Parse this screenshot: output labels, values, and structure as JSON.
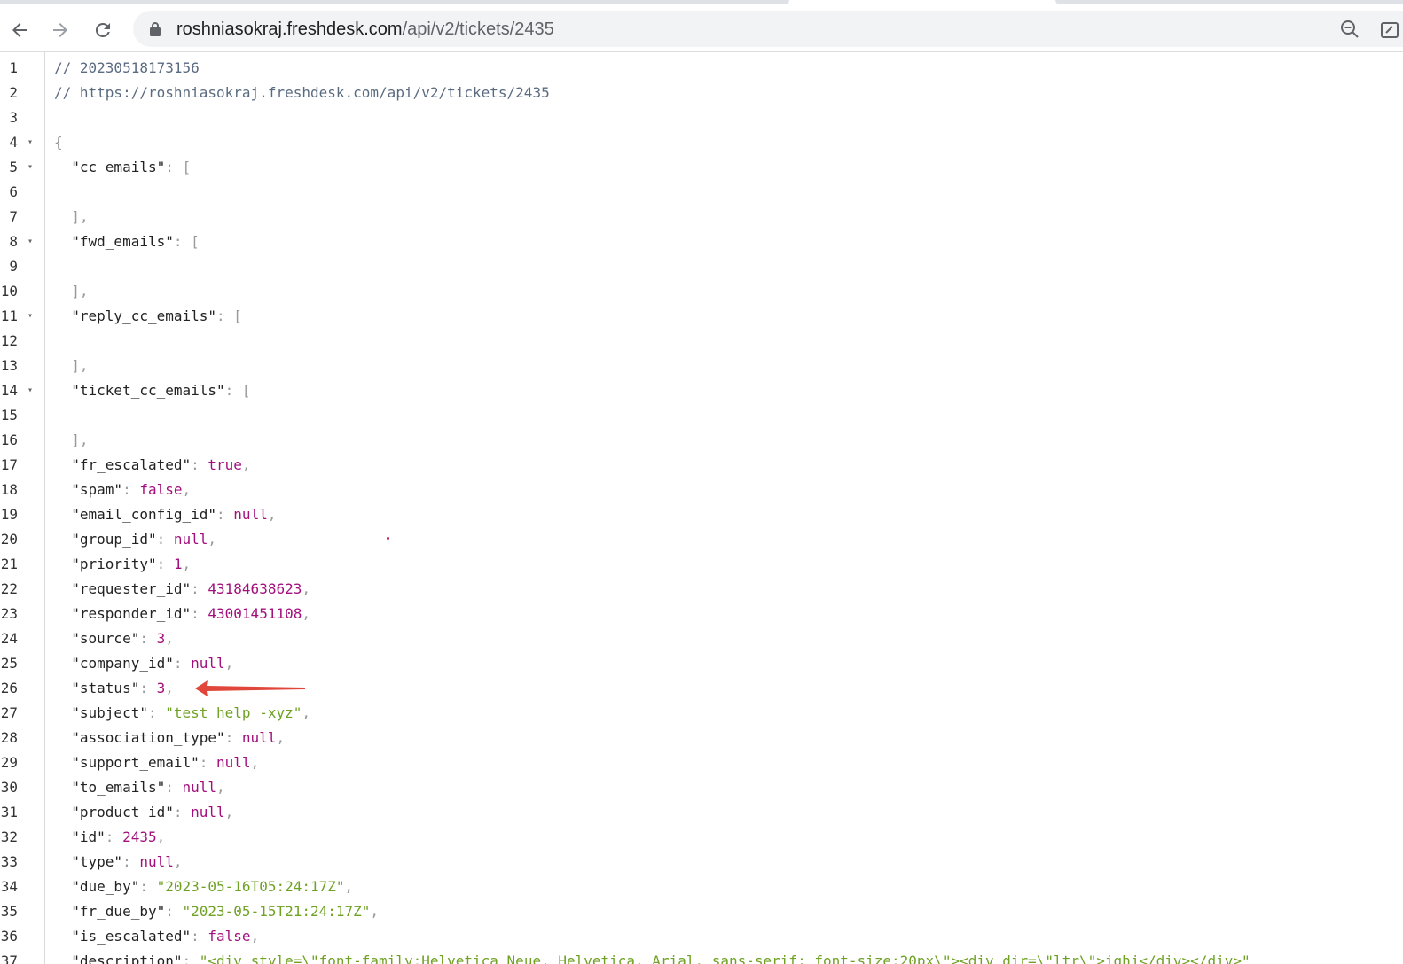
{
  "browser": {
    "url_host": "roshniasokraj.freshdesk.com",
    "url_path": "/api/v2/tickets/2435",
    "icons": {
      "back": "arrow-left-icon",
      "forward": "arrow-right-icon",
      "reload": "reload-icon",
      "lock": "lock-icon",
      "zoom": "zoom-out-icon"
    }
  },
  "json_view": {
    "lines": [
      {
        "n": "1",
        "fold": "",
        "tokens": [
          {
            "t": "// 20230518173156",
            "c": "comment"
          }
        ]
      },
      {
        "n": "2",
        "fold": "",
        "tokens": [
          {
            "t": "// https://roshniasokraj.freshdesk.com/api/v2/tickets/2435",
            "c": "comment"
          }
        ]
      },
      {
        "n": "3",
        "fold": "",
        "tokens": []
      },
      {
        "n": "4",
        "fold": "▾",
        "tokens": [
          {
            "t": "{",
            "c": "punct"
          }
        ]
      },
      {
        "n": "5",
        "fold": "▾",
        "tokens": [
          {
            "t": "  \"cc_emails\"",
            "c": "key"
          },
          {
            "t": ": [",
            "c": "punct"
          }
        ]
      },
      {
        "n": "6",
        "fold": "",
        "tokens": []
      },
      {
        "n": "7",
        "fold": "",
        "tokens": [
          {
            "t": "  ],",
            "c": "punct"
          }
        ]
      },
      {
        "n": "8",
        "fold": "▾",
        "tokens": [
          {
            "t": "  \"fwd_emails\"",
            "c": "key"
          },
          {
            "t": ": [",
            "c": "punct"
          }
        ]
      },
      {
        "n": "9",
        "fold": "",
        "tokens": []
      },
      {
        "n": "10",
        "fold": "",
        "tokens": [
          {
            "t": "  ],",
            "c": "punct"
          }
        ]
      },
      {
        "n": "11",
        "fold": "▾",
        "tokens": [
          {
            "t": "  \"reply_cc_emails\"",
            "c": "key"
          },
          {
            "t": ": [",
            "c": "punct"
          }
        ]
      },
      {
        "n": "12",
        "fold": "",
        "tokens": []
      },
      {
        "n": "13",
        "fold": "",
        "tokens": [
          {
            "t": "  ],",
            "c": "punct"
          }
        ]
      },
      {
        "n": "14",
        "fold": "▾",
        "tokens": [
          {
            "t": "  \"ticket_cc_emails\"",
            "c": "key"
          },
          {
            "t": ": [",
            "c": "punct"
          }
        ]
      },
      {
        "n": "15",
        "fold": "",
        "tokens": []
      },
      {
        "n": "16",
        "fold": "",
        "tokens": [
          {
            "t": "  ],",
            "c": "punct"
          }
        ]
      },
      {
        "n": "17",
        "fold": "",
        "tokens": [
          {
            "t": "  \"fr_escalated\"",
            "c": "key"
          },
          {
            "t": ": ",
            "c": "punct"
          },
          {
            "t": "true",
            "c": "bool"
          },
          {
            "t": ",",
            "c": "punct"
          }
        ]
      },
      {
        "n": "18",
        "fold": "",
        "tokens": [
          {
            "t": "  \"spam\"",
            "c": "key"
          },
          {
            "t": ": ",
            "c": "punct"
          },
          {
            "t": "false",
            "c": "bool"
          },
          {
            "t": ",",
            "c": "punct"
          }
        ]
      },
      {
        "n": "19",
        "fold": "",
        "tokens": [
          {
            "t": "  \"email_config_id\"",
            "c": "key"
          },
          {
            "t": ": ",
            "c": "punct"
          },
          {
            "t": "null",
            "c": "null"
          },
          {
            "t": ",",
            "c": "punct"
          }
        ]
      },
      {
        "n": "20",
        "fold": "",
        "tokens": [
          {
            "t": "  \"group_id\"",
            "c": "key"
          },
          {
            "t": ": ",
            "c": "punct"
          },
          {
            "t": "null",
            "c": "null"
          },
          {
            "t": ",",
            "c": "punct"
          }
        ]
      },
      {
        "n": "21",
        "fold": "",
        "tokens": [
          {
            "t": "  \"priority\"",
            "c": "key"
          },
          {
            "t": ": ",
            "c": "punct"
          },
          {
            "t": "1",
            "c": "num"
          },
          {
            "t": ",",
            "c": "punct"
          }
        ]
      },
      {
        "n": "22",
        "fold": "",
        "tokens": [
          {
            "t": "  \"requester_id\"",
            "c": "key"
          },
          {
            "t": ": ",
            "c": "punct"
          },
          {
            "t": "43184638623",
            "c": "num"
          },
          {
            "t": ",",
            "c": "punct"
          }
        ]
      },
      {
        "n": "23",
        "fold": "",
        "tokens": [
          {
            "t": "  \"responder_id\"",
            "c": "key"
          },
          {
            "t": ": ",
            "c": "punct"
          },
          {
            "t": "43001451108",
            "c": "num"
          },
          {
            "t": ",",
            "c": "punct"
          }
        ]
      },
      {
        "n": "24",
        "fold": "",
        "tokens": [
          {
            "t": "  \"source\"",
            "c": "key"
          },
          {
            "t": ": ",
            "c": "punct"
          },
          {
            "t": "3",
            "c": "num"
          },
          {
            "t": ",",
            "c": "punct"
          }
        ]
      },
      {
        "n": "25",
        "fold": "",
        "tokens": [
          {
            "t": "  \"company_id\"",
            "c": "key"
          },
          {
            "t": ": ",
            "c": "punct"
          },
          {
            "t": "null",
            "c": "null"
          },
          {
            "t": ",",
            "c": "punct"
          }
        ]
      },
      {
        "n": "26",
        "fold": "",
        "tokens": [
          {
            "t": "  \"status\"",
            "c": "key"
          },
          {
            "t": ": ",
            "c": "punct"
          },
          {
            "t": "3",
            "c": "num"
          },
          {
            "t": ",",
            "c": "punct"
          }
        ]
      },
      {
        "n": "27",
        "fold": "",
        "tokens": [
          {
            "t": "  \"subject\"",
            "c": "key"
          },
          {
            "t": ": ",
            "c": "punct"
          },
          {
            "t": "\"test help -xyz\"",
            "c": "str"
          },
          {
            "t": ",",
            "c": "punct"
          }
        ]
      },
      {
        "n": "28",
        "fold": "",
        "tokens": [
          {
            "t": "  \"association_type\"",
            "c": "key"
          },
          {
            "t": ": ",
            "c": "punct"
          },
          {
            "t": "null",
            "c": "null"
          },
          {
            "t": ",",
            "c": "punct"
          }
        ]
      },
      {
        "n": "29",
        "fold": "",
        "tokens": [
          {
            "t": "  \"support_email\"",
            "c": "key"
          },
          {
            "t": ": ",
            "c": "punct"
          },
          {
            "t": "null",
            "c": "null"
          },
          {
            "t": ",",
            "c": "punct"
          }
        ]
      },
      {
        "n": "30",
        "fold": "",
        "tokens": [
          {
            "t": "  \"to_emails\"",
            "c": "key"
          },
          {
            "t": ": ",
            "c": "punct"
          },
          {
            "t": "null",
            "c": "null"
          },
          {
            "t": ",",
            "c": "punct"
          }
        ]
      },
      {
        "n": "31",
        "fold": "",
        "tokens": [
          {
            "t": "  \"product_id\"",
            "c": "key"
          },
          {
            "t": ": ",
            "c": "punct"
          },
          {
            "t": "null",
            "c": "null"
          },
          {
            "t": ",",
            "c": "punct"
          }
        ]
      },
      {
        "n": "32",
        "fold": "",
        "tokens": [
          {
            "t": "  \"id\"",
            "c": "key"
          },
          {
            "t": ": ",
            "c": "punct"
          },
          {
            "t": "2435",
            "c": "num"
          },
          {
            "t": ",",
            "c": "punct"
          }
        ]
      },
      {
        "n": "33",
        "fold": "",
        "tokens": [
          {
            "t": "  \"type\"",
            "c": "key"
          },
          {
            "t": ": ",
            "c": "punct"
          },
          {
            "t": "null",
            "c": "null"
          },
          {
            "t": ",",
            "c": "punct"
          }
        ]
      },
      {
        "n": "34",
        "fold": "",
        "tokens": [
          {
            "t": "  \"due_by\"",
            "c": "key"
          },
          {
            "t": ": ",
            "c": "punct"
          },
          {
            "t": "\"2023-05-16T05:24:17Z\"",
            "c": "str"
          },
          {
            "t": ",",
            "c": "punct"
          }
        ]
      },
      {
        "n": "35",
        "fold": "",
        "tokens": [
          {
            "t": "  \"fr_due_by\"",
            "c": "key"
          },
          {
            "t": ": ",
            "c": "punct"
          },
          {
            "t": "\"2023-05-15T21:24:17Z\"",
            "c": "str"
          },
          {
            "t": ",",
            "c": "punct"
          }
        ]
      },
      {
        "n": "36",
        "fold": "",
        "tokens": [
          {
            "t": "  \"is_escalated\"",
            "c": "key"
          },
          {
            "t": ": ",
            "c": "punct"
          },
          {
            "t": "false",
            "c": "bool"
          },
          {
            "t": ",",
            "c": "punct"
          }
        ]
      },
      {
        "n": "37",
        "fold": "",
        "tokens": [
          {
            "t": "  \"description\"",
            "c": "key"
          },
          {
            "t": ": ",
            "c": "punct"
          },
          {
            "t": "\"<div style=\\\"font-family:Helvetica Neue, Helvetica, Arial, sans-serif; font-size:20px\\\"><div dir=\\\"ltr\\\">ighj</div></div>\"",
            "c": "str"
          }
        ]
      }
    ]
  },
  "annotation": {
    "arrow_color": "#e0473a",
    "dot_color": "#c0175f"
  }
}
